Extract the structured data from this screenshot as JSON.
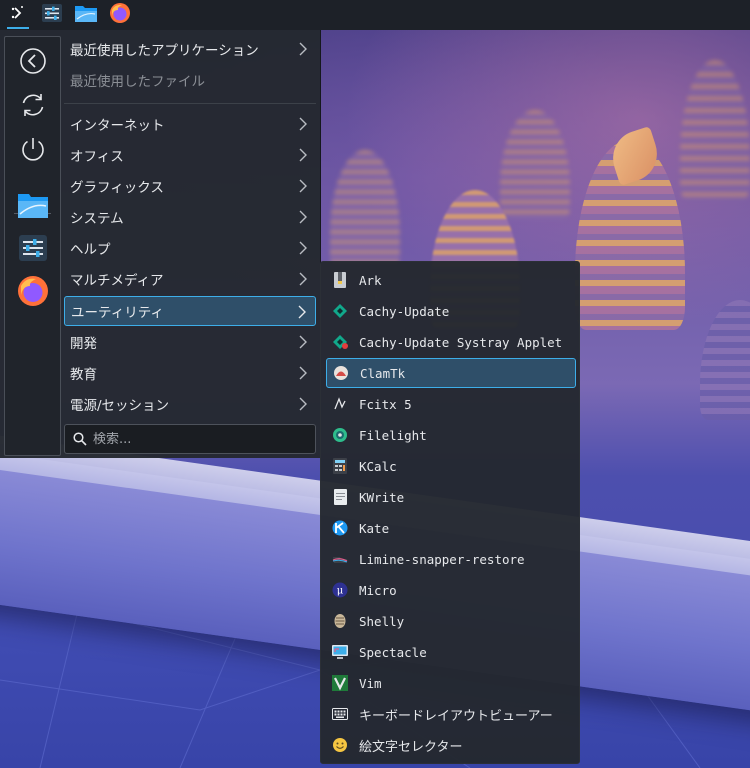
{
  "launcher": {
    "categories": [
      {
        "label": "最近使用したアプリケーション",
        "has_submenu": true
      },
      {
        "label": "最近使用したファイル",
        "has_submenu": false
      },
      {
        "label": "インターネット",
        "has_submenu": true
      },
      {
        "label": "オフィス",
        "has_submenu": true
      },
      {
        "label": "グラフィックス",
        "has_submenu": true
      },
      {
        "label": "システム",
        "has_submenu": true
      },
      {
        "label": "ヘルプ",
        "has_submenu": true
      },
      {
        "label": "マルチメディア",
        "has_submenu": true
      },
      {
        "label": "ユーティリティ",
        "has_submenu": true,
        "selected": true
      },
      {
        "label": "開発",
        "has_submenu": true
      },
      {
        "label": "教育",
        "has_submenu": true
      },
      {
        "label": "電源/セッション",
        "has_submenu": true
      }
    ],
    "search_placeholder": "検索...",
    "left_column": [
      "back-icon",
      "refresh-icon",
      "power-icon",
      "file-manager-icon",
      "system-settings-icon",
      "firefox-icon"
    ]
  },
  "submenu": {
    "items": [
      {
        "label": "Ark",
        "icon": "ark-icon"
      },
      {
        "label": "Cachy-Update",
        "icon": "cachy-update-icon"
      },
      {
        "label": "Cachy-Update Systray Applet",
        "icon": "cachy-update-systray-icon"
      },
      {
        "label": "ClamTk",
        "icon": "clamtk-icon",
        "selected": true
      },
      {
        "label": "Fcitx 5",
        "icon": "fcitx-icon"
      },
      {
        "label": "Filelight",
        "icon": "filelight-icon"
      },
      {
        "label": "KCalc",
        "icon": "kcalc-icon"
      },
      {
        "label": "KWrite",
        "icon": "kwrite-icon"
      },
      {
        "label": "Kate",
        "icon": "kate-icon"
      },
      {
        "label": "Limine-snapper-restore",
        "icon": "limine-icon"
      },
      {
        "label": "Micro",
        "icon": "micro-icon"
      },
      {
        "label": "Shelly",
        "icon": "shelly-icon"
      },
      {
        "label": "Spectacle",
        "icon": "spectacle-icon"
      },
      {
        "label": "Vim",
        "icon": "vim-icon"
      },
      {
        "label": "キーボードレイアウトビューアー",
        "icon": "keyboard-icon"
      },
      {
        "label": "絵文字セレクター",
        "icon": "emoji-icon"
      }
    ]
  },
  "panel": {
    "icons": [
      "application-launcher-icon",
      "system-settings-icon",
      "file-manager-icon",
      "firefox-icon"
    ]
  },
  "colors": {
    "accent": "#3daee9",
    "selection_bg": "#2f4f69",
    "menu_bg": "#242830",
    "panel_bg": "#1d2128"
  }
}
